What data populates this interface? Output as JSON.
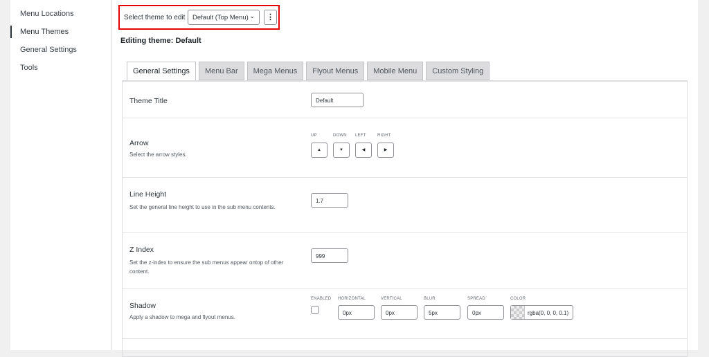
{
  "sidebar": {
    "items": [
      {
        "label": "Menu Locations"
      },
      {
        "label": "Menu Themes"
      },
      {
        "label": "General Settings"
      },
      {
        "label": "Tools"
      }
    ]
  },
  "selector": {
    "label": "Select theme to edit",
    "value": "Default (Top Menu)",
    "more": "⋮"
  },
  "editing": "Editing theme: Default",
  "tabs": [
    "General Settings",
    "Menu Bar",
    "Mega Menus",
    "Flyout Menus",
    "Mobile Menu",
    "Custom Styling"
  ],
  "rows": {
    "theme_title": {
      "title": "Theme Title",
      "value": "Default"
    },
    "arrow": {
      "title": "Arrow",
      "desc": "Select the arrow styles.",
      "labels": [
        "UP",
        "DOWN",
        "LEFT",
        "RIGHT"
      ],
      "glyphs": [
        "▲",
        "▼",
        "◀",
        "▶"
      ]
    },
    "line_height": {
      "title": "Line Height",
      "desc": "Set the general line height to use in the sub menu contents.",
      "value": "1.7"
    },
    "z_index": {
      "title": "Z Index",
      "desc": "Set the z-index to ensure the sub menus appear ontop of other content.",
      "value": "999"
    },
    "shadow": {
      "title": "Shadow",
      "desc": "Apply a shadow to mega and flyout menus.",
      "labels": {
        "enabled": "ENABLED",
        "horizontal": "HORIZONTAL",
        "vertical": "VERTICAL",
        "blur": "BLUR",
        "spread": "SPREAD",
        "color": "COLOR"
      },
      "values": {
        "horizontal": "0px",
        "vertical": "0px",
        "blur": "5px",
        "spread": "0px",
        "color": "rgba(0, 0, 0, 0.1)"
      },
      "enabled": false
    }
  }
}
